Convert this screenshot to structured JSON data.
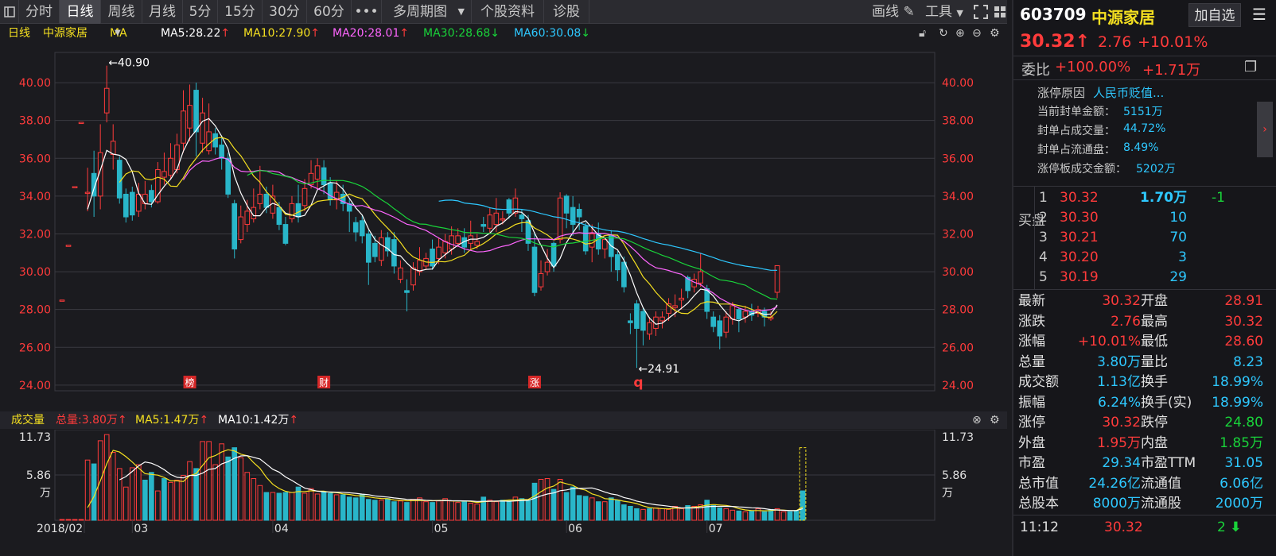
{
  "toolbar": {
    "tabs": [
      "分时",
      "日线",
      "周线",
      "月线",
      "5分",
      "15分",
      "30分",
      "60分"
    ],
    "active_tab": "日线",
    "more_label": "•••",
    "multi_period_label": "多周期图",
    "stock_info_label": "个股资料",
    "diagnose_label": "诊股",
    "draw_label": "画线",
    "tools_label": "工具"
  },
  "ma_line": {
    "period": "日线",
    "stock_name": "中源家居",
    "indicator": "MA",
    "ma5": "MA5:28.22",
    "ma10": "MA10:27.90",
    "ma20": "MA20:28.01",
    "ma30": "MA30:28.68",
    "ma60": "MA60:30.08"
  },
  "colors": {
    "up": "#ff3b3b",
    "down": "#29b6c9",
    "ma5": "#ffffff",
    "ma10": "#f5e020",
    "ma20": "#ff66ff",
    "ma30": "#19d33a",
    "ma60": "#2ec8ff",
    "grid": "#3a3a40"
  },
  "chart_data": {
    "type": "candlestick",
    "y_ticks": [
      "40.00",
      "38.00",
      "36.00",
      "34.00",
      "32.00",
      "30.00",
      "28.00",
      "26.00",
      "24.00"
    ],
    "ylim": [
      23.7,
      41.6
    ],
    "max_label": "40.90",
    "min_label": "24.91",
    "x_labels": [
      "2018/02",
      "03",
      "04",
      "05",
      "06",
      "07"
    ],
    "event_markers": [
      "榜",
      "财",
      "涨"
    ],
    "event_marker_q": "q",
    "candles": [
      {
        "o": 28.5,
        "c": 28.5,
        "h": 28.5,
        "l": 28.5
      },
      {
        "o": 31.4,
        "c": 31.4,
        "h": 31.4,
        "l": 31.4
      },
      {
        "o": 34.5,
        "c": 34.5,
        "h": 34.5,
        "l": 34.5
      },
      {
        "o": 37.9,
        "c": 37.9,
        "h": 37.9,
        "l": 37.9
      },
      {
        "o": 34.2,
        "c": 34.2,
        "h": 35.5,
        "l": 33.2
      },
      {
        "o": 35.2,
        "c": 34.0,
        "h": 36.4,
        "l": 32.9
      },
      {
        "o": 34.0,
        "c": 36.3,
        "h": 37.8,
        "l": 33.3
      },
      {
        "o": 38.4,
        "c": 39.7,
        "h": 40.9,
        "l": 37.9
      },
      {
        "o": 36.2,
        "c": 36.9,
        "h": 37.8,
        "l": 35.4
      },
      {
        "o": 35.9,
        "c": 33.9,
        "h": 36.1,
        "l": 33.6
      },
      {
        "o": 34.1,
        "c": 32.9,
        "h": 34.4,
        "l": 32.6
      },
      {
        "o": 34.2,
        "c": 33.0,
        "h": 34.5,
        "l": 32.7
      },
      {
        "o": 33.2,
        "c": 34.1,
        "h": 34.7,
        "l": 32.9
      },
      {
        "o": 33.6,
        "c": 34.1,
        "h": 34.8,
        "l": 33.3
      },
      {
        "o": 34.3,
        "c": 33.7,
        "h": 34.6,
        "l": 33.4
      },
      {
        "o": 33.7,
        "c": 35.4,
        "h": 35.8,
        "l": 33.6
      },
      {
        "o": 35.0,
        "c": 35.3,
        "h": 36.3,
        "l": 34.6
      },
      {
        "o": 35.1,
        "c": 36.0,
        "h": 36.8,
        "l": 34.9
      },
      {
        "o": 35.4,
        "c": 36.7,
        "h": 37.3,
        "l": 35.2
      },
      {
        "o": 36.8,
        "c": 38.5,
        "h": 39.6,
        "l": 36.3
      },
      {
        "o": 37.6,
        "c": 38.8,
        "h": 39.9,
        "l": 36.9
      },
      {
        "o": 39.6,
        "c": 37.4,
        "h": 40.0,
        "l": 36.1
      },
      {
        "o": 36.8,
        "c": 38.4,
        "h": 39.2,
        "l": 36.3
      },
      {
        "o": 36.4,
        "c": 37.4,
        "h": 38.9,
        "l": 36.2
      },
      {
        "o": 37.3,
        "c": 36.6,
        "h": 37.6,
        "l": 36.2
      },
      {
        "o": 36.7,
        "c": 36.0,
        "h": 37.2,
        "l": 35.4
      },
      {
        "o": 36.0,
        "c": 34.1,
        "h": 36.3,
        "l": 33.9
      },
      {
        "o": 33.6,
        "c": 31.2,
        "h": 33.8,
        "l": 30.7
      },
      {
        "o": 31.7,
        "c": 32.9,
        "h": 33.5,
        "l": 31.5
      },
      {
        "o": 32.5,
        "c": 33.2,
        "h": 33.8,
        "l": 32.1
      },
      {
        "o": 32.8,
        "c": 33.4,
        "h": 34.4,
        "l": 32.6
      },
      {
        "o": 33.6,
        "c": 34.1,
        "h": 35.6,
        "l": 33.3
      },
      {
        "o": 34.1,
        "c": 33.4,
        "h": 34.5,
        "l": 33.1
      },
      {
        "o": 33.1,
        "c": 34.0,
        "h": 34.6,
        "l": 32.8
      },
      {
        "o": 33.4,
        "c": 32.5,
        "h": 33.7,
        "l": 32.2
      },
      {
        "o": 32.5,
        "c": 31.5,
        "h": 32.9,
        "l": 31.4
      },
      {
        "o": 32.8,
        "c": 33.6,
        "h": 34.0,
        "l": 32.6
      },
      {
        "o": 33.6,
        "c": 32.9,
        "h": 34.6,
        "l": 32.6
      },
      {
        "o": 33.5,
        "c": 34.4,
        "h": 34.9,
        "l": 33.2
      },
      {
        "o": 34.6,
        "c": 35.2,
        "h": 35.9,
        "l": 34.4
      },
      {
        "o": 34.9,
        "c": 35.6,
        "h": 36.0,
        "l": 34.4
      },
      {
        "o": 35.5,
        "c": 34.6,
        "h": 35.9,
        "l": 34.1
      },
      {
        "o": 34.7,
        "c": 33.8,
        "h": 35.0,
        "l": 33.5
      },
      {
        "o": 33.8,
        "c": 34.2,
        "h": 34.8,
        "l": 33.3
      },
      {
        "o": 34.1,
        "c": 33.6,
        "h": 34.6,
        "l": 33.2
      },
      {
        "o": 33.6,
        "c": 33.2,
        "h": 33.9,
        "l": 32.1
      },
      {
        "o": 32.6,
        "c": 32.1,
        "h": 32.9,
        "l": 31.6
      },
      {
        "o": 32.7,
        "c": 31.9,
        "h": 33.0,
        "l": 31.5
      },
      {
        "o": 32.0,
        "c": 30.5,
        "h": 32.2,
        "l": 29.3
      },
      {
        "o": 31.5,
        "c": 30.8,
        "h": 31.9,
        "l": 30.5
      },
      {
        "o": 30.6,
        "c": 31.8,
        "h": 32.2,
        "l": 30.3
      },
      {
        "o": 31.8,
        "c": 31.1,
        "h": 32.1,
        "l": 30.8
      },
      {
        "o": 31.7,
        "c": 30.3,
        "h": 32.1,
        "l": 29.9
      },
      {
        "o": 29.6,
        "c": 30.2,
        "h": 30.6,
        "l": 29.4
      },
      {
        "o": 29.0,
        "c": 28.9,
        "h": 29.6,
        "l": 27.9
      },
      {
        "o": 29.3,
        "c": 30.2,
        "h": 30.5,
        "l": 29.0
      },
      {
        "o": 30.0,
        "c": 30.6,
        "h": 31.3,
        "l": 29.8
      },
      {
        "o": 30.3,
        "c": 30.7,
        "h": 31.0,
        "l": 30.1
      },
      {
        "o": 31.2,
        "c": 30.3,
        "h": 31.7,
        "l": 30.1
      },
      {
        "o": 30.7,
        "c": 31.3,
        "h": 31.8,
        "l": 30.4
      },
      {
        "o": 31.0,
        "c": 31.6,
        "h": 32.0,
        "l": 30.7
      },
      {
        "o": 31.2,
        "c": 31.9,
        "h": 32.4,
        "l": 30.9
      },
      {
        "o": 31.5,
        "c": 31.9,
        "h": 32.3,
        "l": 31.3
      },
      {
        "o": 31.8,
        "c": 31.3,
        "h": 32.3,
        "l": 31.0
      },
      {
        "o": 31.5,
        "c": 31.9,
        "h": 32.7,
        "l": 31.2
      },
      {
        "o": 31.4,
        "c": 31.6,
        "h": 32.0,
        "l": 31.2
      },
      {
        "o": 32.5,
        "c": 32.4,
        "h": 32.9,
        "l": 32.1
      },
      {
        "o": 32.3,
        "c": 33.0,
        "h": 33.4,
        "l": 32.0
      },
      {
        "o": 32.5,
        "c": 33.1,
        "h": 33.9,
        "l": 32.1
      },
      {
        "o": 32.8,
        "c": 32.8,
        "h": 33.2,
        "l": 32.5
      },
      {
        "o": 33.8,
        "c": 33.1,
        "h": 33.9,
        "l": 32.8
      },
      {
        "o": 33.1,
        "c": 33.9,
        "h": 34.4,
        "l": 32.9
      },
      {
        "o": 33.0,
        "c": 32.8,
        "h": 33.3,
        "l": 32.1
      },
      {
        "o": 32.7,
        "c": 31.5,
        "h": 33.0,
        "l": 31.1
      },
      {
        "o": 31.3,
        "c": 28.9,
        "h": 32.1,
        "l": 28.7
      },
      {
        "o": 29.2,
        "c": 29.9,
        "h": 30.6,
        "l": 29.0
      },
      {
        "o": 30.0,
        "c": 30.5,
        "h": 31.2,
        "l": 29.8
      },
      {
        "o": 31.5,
        "c": 30.3,
        "h": 31.6,
        "l": 30.0
      },
      {
        "o": 31.7,
        "c": 33.9,
        "h": 34.2,
        "l": 31.5
      },
      {
        "o": 34.0,
        "c": 33.1,
        "h": 34.1,
        "l": 32.3
      },
      {
        "o": 33.4,
        "c": 32.5,
        "h": 34.0,
        "l": 31.9
      },
      {
        "o": 33.3,
        "c": 32.9,
        "h": 33.6,
        "l": 32.2
      },
      {
        "o": 32.4,
        "c": 31.1,
        "h": 32.6,
        "l": 30.9
      },
      {
        "o": 31.3,
        "c": 32.0,
        "h": 32.5,
        "l": 30.5
      },
      {
        "o": 32.0,
        "c": 31.2,
        "h": 32.6,
        "l": 30.9
      },
      {
        "o": 31.2,
        "c": 31.7,
        "h": 31.9,
        "l": 30.7
      },
      {
        "o": 31.9,
        "c": 30.8,
        "h": 32.2,
        "l": 30.0
      },
      {
        "o": 30.9,
        "c": 30.1,
        "h": 31.1,
        "l": 29.5
      },
      {
        "o": 30.5,
        "c": 29.2,
        "h": 30.8,
        "l": 28.9
      },
      {
        "o": 27.4,
        "c": 27.3,
        "h": 27.8,
        "l": 26.7
      },
      {
        "o": 28.3,
        "c": 27.0,
        "h": 28.5,
        "l": 24.91
      },
      {
        "o": 27.9,
        "c": 26.9,
        "h": 28.1,
        "l": 26.1
      },
      {
        "o": 26.7,
        "c": 27.3,
        "h": 27.6,
        "l": 26.4
      },
      {
        "o": 27.0,
        "c": 27.6,
        "h": 27.9,
        "l": 26.6
      },
      {
        "o": 27.4,
        "c": 27.6,
        "h": 27.9,
        "l": 27.0
      },
      {
        "o": 27.8,
        "c": 28.3,
        "h": 28.6,
        "l": 27.4
      },
      {
        "o": 28.1,
        "c": 28.2,
        "h": 28.8,
        "l": 27.6
      },
      {
        "o": 28.5,
        "c": 28.6,
        "h": 29.1,
        "l": 28.0
      },
      {
        "o": 29.7,
        "c": 29.0,
        "h": 29.8,
        "l": 28.6
      },
      {
        "o": 29.2,
        "c": 29.6,
        "h": 29.9,
        "l": 28.9
      },
      {
        "o": 29.4,
        "c": 30.0,
        "h": 31.0,
        "l": 29.2
      },
      {
        "o": 29.1,
        "c": 27.9,
        "h": 29.3,
        "l": 27.5
      },
      {
        "o": 27.6,
        "c": 27.1,
        "h": 27.9,
        "l": 26.8
      },
      {
        "o": 27.4,
        "c": 26.6,
        "h": 27.7,
        "l": 25.9
      },
      {
        "o": 26.8,
        "c": 27.6,
        "h": 27.9,
        "l": 26.5
      },
      {
        "o": 27.5,
        "c": 28.2,
        "h": 28.4,
        "l": 27.2
      },
      {
        "o": 28.0,
        "c": 27.5,
        "h": 28.1,
        "l": 26.8
      },
      {
        "o": 27.6,
        "c": 27.9,
        "h": 28.2,
        "l": 27.3
      },
      {
        "o": 27.9,
        "c": 27.7,
        "h": 28.3,
        "l": 27.4
      },
      {
        "o": 27.8,
        "c": 28.0,
        "h": 28.2,
        "l": 27.6
      },
      {
        "o": 27.9,
        "c": 27.6,
        "h": 28.1,
        "l": 27.1
      },
      {
        "o": 27.5,
        "c": 27.6,
        "h": 27.9,
        "l": 27.4
      },
      {
        "o": 28.91,
        "c": 30.32,
        "h": 30.32,
        "l": 28.6
      }
    ],
    "volume": {
      "y_ticks": [
        "11.73",
        "5.86",
        "万"
      ],
      "ylim": [
        0,
        11.73
      ],
      "values": [
        0.1,
        0.1,
        0.1,
        0.1,
        7.8,
        7.3,
        10.3,
        11.1,
        8.8,
        6.7,
        4.3,
        6.8,
        7.2,
        5.2,
        6.2,
        3.8,
        5.4,
        4.9,
        5.2,
        5.8,
        7.6,
        6.7,
        10.2,
        10.2,
        7.2,
        9.9,
        8.2,
        9.4,
        8.1,
        6.2,
        5.4,
        4.5,
        3.6,
        3.6,
        3.5,
        3.6,
        3.6,
        4.3,
        3.5,
        4.1,
        3.4,
        3.6,
        3.5,
        3.3,
        3.3,
        3.0,
        2.9,
        3.3,
        2.7,
        2.6,
        2.6,
        2.8,
        2.4,
        2.5,
        2.3,
        2.7,
        2.9,
        2.4,
        2.3,
        2.5,
        2.8,
        2.5,
        2.3,
        2.4,
        2.2,
        2.1,
        3.0,
        2.6,
        2.4,
        2.6,
        2.5,
        3.0,
        2.8,
        2.6,
        4.8,
        5.3,
        5.4,
        4.0,
        5.3,
        3.6,
        4.3,
        3.2,
        3.1,
        2.9,
        2.4,
        2.4,
        2.9,
        2.6,
        2.0,
        1.8,
        1.5,
        1.4,
        1.5,
        1.6,
        1.5,
        1.4,
        1.8,
        1.5,
        1.9,
        1.8,
        2.0,
        2.6,
        1.9,
        1.6,
        1.5,
        1.3,
        1.2,
        1.1,
        1.2,
        1.5,
        1.1,
        1.4,
        1.5,
        1.1,
        1.1,
        1.2,
        3.8
      ],
      "up_flags": [
        1,
        1,
        1,
        1,
        1,
        0,
        1,
        1,
        1,
        1,
        1,
        1,
        1,
        0,
        0,
        1,
        0,
        1,
        1,
        1,
        1,
        0,
        1,
        1,
        1,
        1,
        0,
        0,
        1,
        1,
        1,
        1,
        0,
        1,
        0,
        0,
        1,
        0,
        1,
        1,
        1,
        0,
        0,
        1,
        0,
        0,
        0,
        0,
        0,
        0,
        1,
        0,
        0,
        1,
        0,
        1,
        1,
        1,
        0,
        1,
        1,
        1,
        1,
        0,
        1,
        1,
        0,
        1,
        1,
        0,
        0,
        1,
        0,
        0,
        0,
        1,
        1,
        0,
        1,
        0,
        0,
        0,
        0,
        1,
        0,
        1,
        0,
        0,
        0,
        0,
        0,
        1,
        0,
        1,
        1,
        1,
        1,
        1,
        0,
        1,
        1,
        0,
        0,
        0,
        1,
        1,
        0,
        1,
        0,
        1,
        0,
        0,
        1,
        1
      ]
    }
  },
  "vol_header": {
    "title": "成交量",
    "total": "总量:3.80万",
    "ma5": "MA5:1.47万",
    "ma10": "MA10:1.42万"
  },
  "quote": {
    "code": "603709",
    "name": "中源家居",
    "add_watch": "加自选",
    "price": "30.32",
    "change": "2.76",
    "change_pct": "+10.01%",
    "wei_bi_label": "委比",
    "wei_bi": "+100.00%",
    "wei_cha": "+1.71万",
    "limit_reason_label": "涨停原因",
    "limit_reason": "人民币贬值...",
    "seal": [
      {
        "label": "当前封单金额：",
        "value": "5151万"
      },
      {
        "label": "封单占成交量：",
        "value": "44.72%"
      },
      {
        "label": "封单占流通盘：",
        "value": "8.49%"
      },
      {
        "label": "涨停板成交金额：",
        "value": "5202万"
      }
    ],
    "buy_label": "买盘",
    "bids": [
      {
        "level": "1",
        "price": "30.32",
        "vol": "1.70万",
        "chg": "-1"
      },
      {
        "level": "2",
        "price": "30.30",
        "vol": "10",
        "chg": ""
      },
      {
        "level": "3",
        "price": "30.21",
        "vol": "70",
        "chg": ""
      },
      {
        "level": "4",
        "price": "30.20",
        "vol": "3",
        "chg": ""
      },
      {
        "level": "5",
        "price": "30.19",
        "vol": "29",
        "chg": ""
      }
    ],
    "stats": [
      {
        "l1": "最新",
        "v1": "30.32",
        "c1": "red",
        "l2": "开盘",
        "v2": "28.91",
        "c2": "red"
      },
      {
        "l1": "涨跌",
        "v1": "2.76",
        "c1": "red",
        "l2": "最高",
        "v2": "30.32",
        "c2": "red"
      },
      {
        "l1": "涨幅",
        "v1": "+10.01%",
        "c1": "red",
        "l2": "最低",
        "v2": "28.60",
        "c2": "red"
      },
      {
        "l1": "总量",
        "v1": "3.80万",
        "c1": "cyan",
        "l2": "量比",
        "v2": "8.23",
        "c2": "cyan"
      },
      {
        "l1": "成交额",
        "v1": "1.13亿",
        "c1": "cyan",
        "l2": "换手",
        "v2": "18.99%",
        "c2": "cyan"
      },
      {
        "l1": "振幅",
        "v1": "6.24%",
        "c1": "cyan",
        "l2": "换手(实)",
        "v2": "18.99%",
        "c2": "cyan"
      },
      {
        "l1": "涨停",
        "v1": "30.32",
        "c1": "red",
        "l2": "跌停",
        "v2": "24.80",
        "c2": "green"
      },
      {
        "l1": "外盘",
        "v1": "1.95万",
        "c1": "red",
        "l2": "内盘",
        "v2": "1.85万",
        "c2": "green"
      },
      {
        "l1": "市盈",
        "v1": "29.34",
        "c1": "cyan",
        "l2": "市盈TTM",
        "v2": "31.05",
        "c2": "cyan"
      },
      {
        "l1": "总市值",
        "v1": "24.26亿",
        "c1": "cyan",
        "l2": "流通值",
        "v2": "6.06亿",
        "c2": "cyan"
      },
      {
        "l1": "总股本",
        "v1": "8000万",
        "c1": "cyan",
        "l2": "流通股",
        "v2": "2000万",
        "c2": "cyan"
      }
    ],
    "tick": {
      "time": "11:12",
      "price": "30.32",
      "vol": "2"
    }
  }
}
